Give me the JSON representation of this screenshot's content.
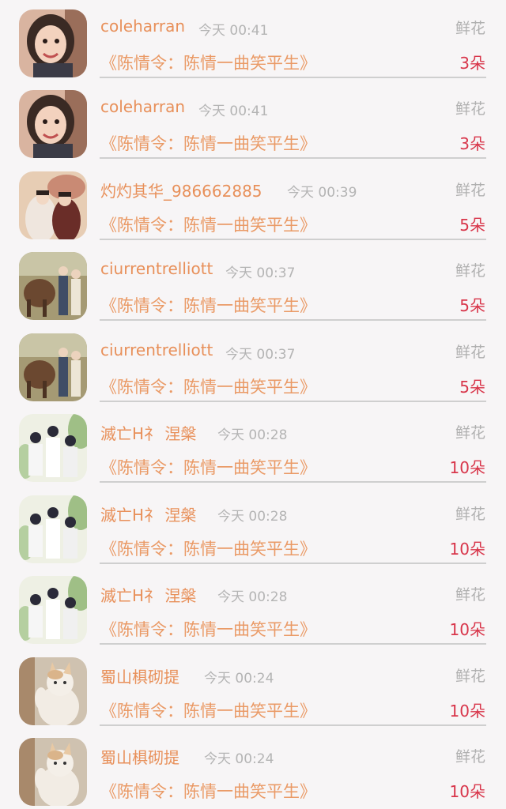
{
  "gift_type_label": "鲜花",
  "program_title": "《陈情令：陈情一曲笑平生》",
  "records": [
    {
      "user": "coleharran",
      "time": "今天 00:41",
      "count": "3朵",
      "avatar_icon": "little-girl-avatar-icon"
    },
    {
      "user": "coleharran",
      "time": "今天 00:41",
      "count": "3朵",
      "avatar_icon": "little-girl-avatar-icon"
    },
    {
      "user": "灼灼其华_986662885",
      "time": "今天 00:39",
      "count": "5朵",
      "avatar_icon": "costume-drama-avatar-icon"
    },
    {
      "user": "ciurrentrelliott",
      "time": "今天 00:37",
      "count": "5朵",
      "avatar_icon": "horse-couple-avatar-icon"
    },
    {
      "user": "ciurrentrelliott",
      "time": "今天 00:37",
      "count": "5朵",
      "avatar_icon": "horse-couple-avatar-icon"
    },
    {
      "user": "滅亡H礻 涅槃",
      "time": "今天 00:28",
      "count": "10朵",
      "avatar_icon": "group-photo-avatar-icon"
    },
    {
      "user": "滅亡H礻 涅槃",
      "time": "今天 00:28",
      "count": "10朵",
      "avatar_icon": "group-photo-avatar-icon"
    },
    {
      "user": "滅亡H礻 涅槃",
      "time": "今天 00:28",
      "count": "10朵",
      "avatar_icon": "group-photo-avatar-icon"
    },
    {
      "user": "蜀山椇砌提",
      "time": "今天 00:24",
      "count": "10朵",
      "avatar_icon": "cat-avatar-icon"
    },
    {
      "user": "蜀山椇砌提",
      "time": "今天 00:24",
      "count": "10朵",
      "avatar_icon": "cat-avatar-icon"
    }
  ]
}
